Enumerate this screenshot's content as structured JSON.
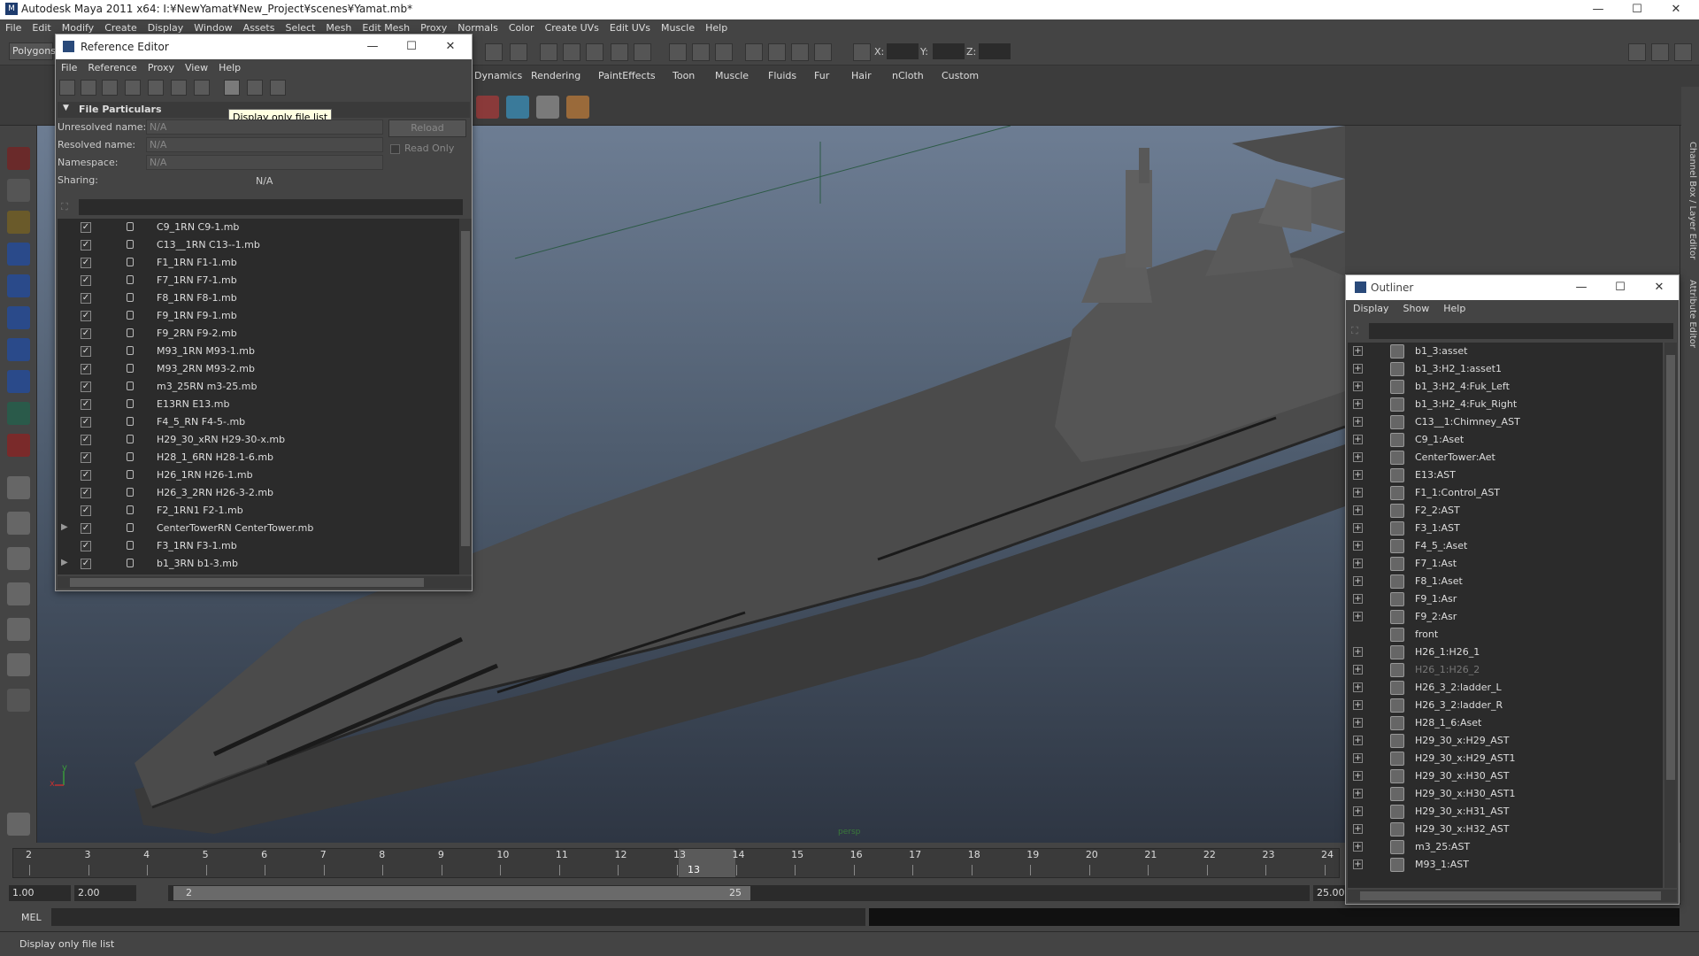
{
  "window": {
    "title": "Autodesk Maya 2011 x64: I:¥NewYamat¥New_Project¥scenes¥Yamat.mb*"
  },
  "menubar": [
    "File",
    "Edit",
    "Modify",
    "Create",
    "Display",
    "Window",
    "Assets",
    "Select",
    "Mesh",
    "Edit Mesh",
    "Proxy",
    "Normals",
    "Color",
    "Create UVs",
    "Edit UVs",
    "Muscle",
    "Help"
  ],
  "statusline": {
    "mode": "Polygons",
    "x_label": "X:",
    "y_label": "Y:",
    "z_label": "Z:"
  },
  "shelf_tabs": [
    "Dynamics",
    "Rendering",
    "PaintEffects",
    "Toon",
    "Muscle",
    "Fluids",
    "Fur",
    "Hair",
    "nCloth",
    "Custom"
  ],
  "reference_editor": {
    "title": "Reference Editor",
    "menu": [
      "File",
      "Reference",
      "Proxy",
      "View",
      "Help"
    ],
    "tooltip": "Display only file list",
    "section_title": "File Particulars",
    "fields": {
      "unresolved_label": "Unresolved name:",
      "unresolved_value": "N/A",
      "resolved_label": "Resolved name:",
      "resolved_value": "N/A",
      "namespace_label": "Namespace:",
      "namespace_value": "N/A",
      "sharing_label": "Sharing:",
      "sharing_value": "N/A"
    },
    "reload_label": "Reload",
    "read_only_label": "Read Only",
    "references": [
      {
        "name": "C9_1RN C9-1.mb",
        "expandable": false
      },
      {
        "name": "C13__1RN C13--1.mb",
        "expandable": false
      },
      {
        "name": "F1_1RN F1-1.mb",
        "expandable": false
      },
      {
        "name": "F7_1RN F7-1.mb",
        "expandable": false
      },
      {
        "name": "F8_1RN F8-1.mb",
        "expandable": false
      },
      {
        "name": "F9_1RN F9-1.mb",
        "expandable": false
      },
      {
        "name": "F9_2RN F9-2.mb",
        "expandable": false
      },
      {
        "name": "M93_1RN M93-1.mb",
        "expandable": false
      },
      {
        "name": "M93_2RN M93-2.mb",
        "expandable": false
      },
      {
        "name": "m3_25RN m3-25.mb",
        "expandable": false
      },
      {
        "name": "E13RN E13.mb",
        "expandable": false
      },
      {
        "name": "F4_5_RN F4-5-.mb",
        "expandable": false
      },
      {
        "name": "H29_30_xRN H29-30-x.mb",
        "expandable": false
      },
      {
        "name": "H28_1_6RN H28-1-6.mb",
        "expandable": false
      },
      {
        "name": "H26_1RN H26-1.mb",
        "expandable": false
      },
      {
        "name": "H26_3_2RN H26-3-2.mb",
        "expandable": false
      },
      {
        "name": "F2_1RN1 F2-1.mb",
        "expandable": false
      },
      {
        "name": "CenterTowerRN CenterTower.mb",
        "expandable": true
      },
      {
        "name": "F3_1RN F3-1.mb",
        "expandable": false
      },
      {
        "name": "b1_3RN b1-3.mb",
        "expandable": true
      }
    ]
  },
  "outliner": {
    "title": "Outliner",
    "menu": [
      "Display",
      "Show",
      "Help"
    ],
    "items": [
      {
        "name": "b1_3:asset",
        "dim": false,
        "plus": true
      },
      {
        "name": "b1_3:H2_1:asset1",
        "dim": false,
        "plus": true
      },
      {
        "name": "b1_3:H2_4:Fuk_Left",
        "dim": false,
        "plus": true
      },
      {
        "name": "b1_3:H2_4:Fuk_Right",
        "dim": false,
        "plus": true
      },
      {
        "name": "C13__1:Chimney_AST",
        "dim": false,
        "plus": true
      },
      {
        "name": "C9_1:Aset",
        "dim": false,
        "plus": true
      },
      {
        "name": "CenterTower:Aet",
        "dim": false,
        "plus": true
      },
      {
        "name": "E13:AST",
        "dim": false,
        "plus": true
      },
      {
        "name": "F1_1:Control_AST",
        "dim": false,
        "plus": true
      },
      {
        "name": "F2_2:AST",
        "dim": false,
        "plus": true
      },
      {
        "name": "F3_1:AST",
        "dim": false,
        "plus": true
      },
      {
        "name": "F4_5_:Aset",
        "dim": false,
        "plus": true
      },
      {
        "name": "F7_1:Ast",
        "dim": false,
        "plus": true
      },
      {
        "name": "F8_1:Aset",
        "dim": false,
        "plus": true
      },
      {
        "name": "F9_1:Asr",
        "dim": false,
        "plus": true
      },
      {
        "name": "F9_2:Asr",
        "dim": false,
        "plus": true
      },
      {
        "name": "front",
        "dim": false,
        "plus": false
      },
      {
        "name": "H26_1:H26_1",
        "dim": false,
        "plus": true
      },
      {
        "name": "H26_1:H26_2",
        "dim": true,
        "plus": true
      },
      {
        "name": "H26_3_2:ladder_L",
        "dim": false,
        "plus": true
      },
      {
        "name": "H26_3_2:ladder_R",
        "dim": false,
        "plus": true
      },
      {
        "name": "H28_1_6:Aset",
        "dim": false,
        "plus": true
      },
      {
        "name": "H29_30_x:H29_AST",
        "dim": false,
        "plus": true
      },
      {
        "name": "H29_30_x:H29_AST1",
        "dim": false,
        "plus": true
      },
      {
        "name": "H29_30_x:H30_AST",
        "dim": false,
        "plus": true
      },
      {
        "name": "H29_30_x:H30_AST1",
        "dim": false,
        "plus": true
      },
      {
        "name": "H29_30_x:H31_AST",
        "dim": false,
        "plus": true
      },
      {
        "name": "H29_30_x:H32_AST",
        "dim": false,
        "plus": true
      },
      {
        "name": "m3_25:AST",
        "dim": false,
        "plus": true
      },
      {
        "name": "M93_1:AST",
        "dim": false,
        "plus": true
      }
    ]
  },
  "right_tabs": {
    "channel_box": "Channel Box / Layer Editor",
    "attribute_editor": "Attribute Editor"
  },
  "viewport": {
    "camera": "persp",
    "axis_x": "x",
    "axis_y": "y"
  },
  "timeslider": {
    "ticks": [
      "2",
      "3",
      "4",
      "5",
      "6",
      "7",
      "8",
      "9",
      "10",
      "11",
      "12",
      "13",
      "14",
      "15",
      "16",
      "17",
      "18",
      "19",
      "20",
      "21",
      "22",
      "23",
      "24"
    ],
    "current_frame": "13"
  },
  "range": {
    "start": "1.00",
    "playback_start": "2.00",
    "range_start": "2",
    "range_end": "25",
    "end": "25.00"
  },
  "cmdline": {
    "label": "MEL"
  },
  "helpline": {
    "text": "Display only file list"
  },
  "colors": {
    "accent": "#5a9bd5",
    "viewport_top": "#6d7d93",
    "viewport_bottom": "#2e3643"
  }
}
